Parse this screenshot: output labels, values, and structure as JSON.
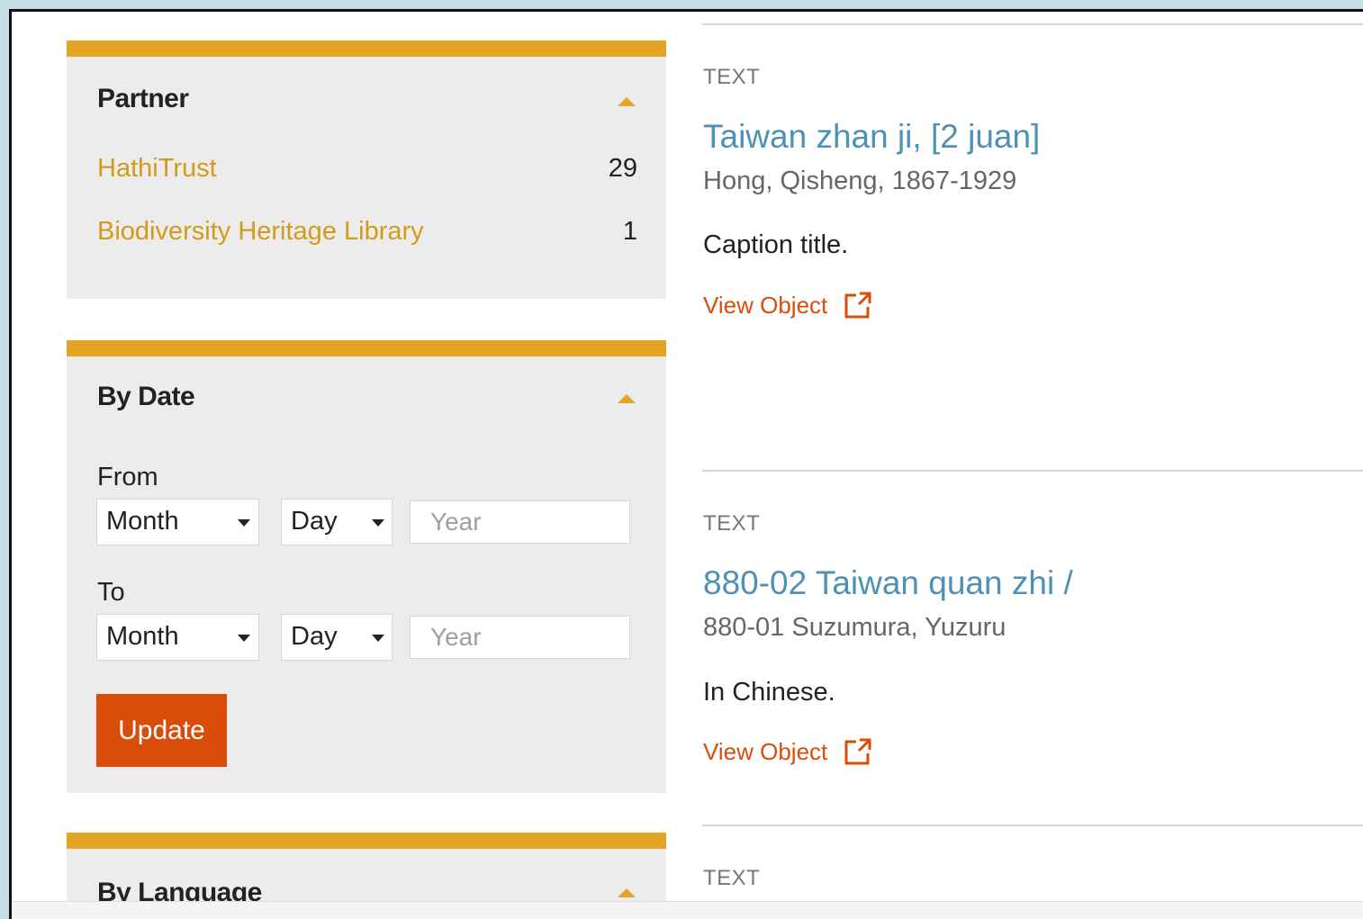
{
  "facets": {
    "partner": {
      "title": "Partner",
      "items": [
        {
          "label": "HathiTrust",
          "count": "29"
        },
        {
          "label": "Biodiversity Heritage Library",
          "count": "1"
        }
      ]
    },
    "by_date": {
      "title": "By Date",
      "from_label": "From",
      "to_label": "To",
      "month_value": "Month",
      "day_value": "Day",
      "year_placeholder": "Year",
      "update_label": "Update"
    },
    "by_language": {
      "title": "By Language"
    }
  },
  "results": [
    {
      "type": "TEXT",
      "title": "Taiwan zhan ji, [2 juan]",
      "author": "Hong, Qisheng, 1867-1929",
      "description": "Caption title.",
      "view_label": "View Object"
    },
    {
      "type": "TEXT",
      "title": "880-02 Taiwan quan zhi /",
      "author": "880-01 Suzumura, Yuzuru",
      "description": "In Chinese.",
      "view_label": "View Object"
    },
    {
      "type": "TEXT"
    }
  ],
  "colors": {
    "facet_accent": "#e5a424",
    "link_gold": "#d39a1c",
    "title_blue": "#4d91b4",
    "action_orange": "#d94c0a"
  }
}
